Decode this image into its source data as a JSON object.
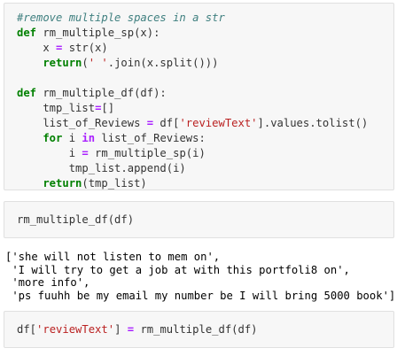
{
  "cells": [
    {
      "lines": [
        {
          "comment": "#remove multiple spaces in a str"
        },
        {
          "kw": "def",
          "rest": " rm_multiple_sp(x):"
        },
        {
          "a": "    x ",
          "op": "=",
          "b": " str(x)"
        },
        {
          "kw": "    return",
          "p1": "(",
          "str": "' '",
          "p2": ".join(x.split()))"
        },
        {
          "blank": ""
        },
        {
          "kw": "def",
          "rest": " rm_multiple_df(df):"
        },
        {
          "a": "    tmp_list",
          "op": "=",
          "b": "[]"
        },
        {
          "a": "    list_of_Reviews ",
          "op": "=",
          "b": " df[",
          "str": "'reviewText'",
          "c": "].values.tolist()"
        },
        {
          "kw": "    for",
          "a": " i ",
          "op": "in",
          "b": " list_of_Reviews:"
        },
        {
          "a": "        i ",
          "op": "=",
          "b": " rm_multiple_sp(i)"
        },
        {
          "a": "        tmp_list.append(i)"
        },
        {
          "kw": "    return",
          "a": "(tmp_list)"
        }
      ]
    },
    {
      "line": "rm_multiple_df(df)"
    },
    {
      "a": "df[",
      "str": "'reviewText'",
      "b": "] ",
      "op": "=",
      "c": " rm_multiple_df(df)"
    }
  ],
  "output": {
    "lines": [
      "['she will not listen to mem on',",
      " 'I will try to get a job at with this portfoli8 on',",
      " 'more info',",
      " 'ps fuuhh be my email my number be I will bring 5000 book']"
    ]
  }
}
